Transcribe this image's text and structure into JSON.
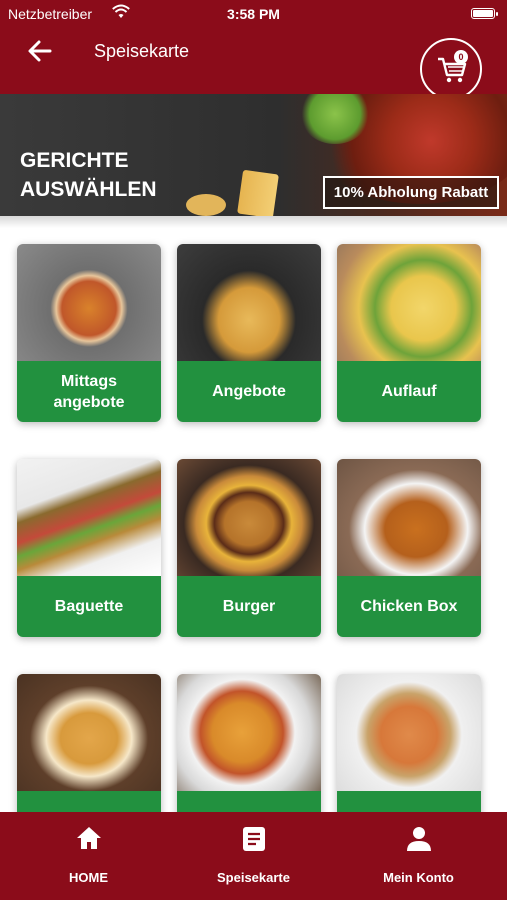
{
  "status_bar": {
    "carrier": "Netzbetreiber",
    "time": "3:58 PM"
  },
  "header": {
    "title": "Speisekarte",
    "cart_count": "0"
  },
  "banner": {
    "title": "GERICHTE AUSWÄHLEN",
    "promo": "10% Abholung Rabatt"
  },
  "categories": [
    {
      "label": "Mittags angebote"
    },
    {
      "label": "Angebote"
    },
    {
      "label": "Auflauf"
    },
    {
      "label": "Baguette"
    },
    {
      "label": "Burger"
    },
    {
      "label": "Chicken Box"
    },
    {
      "label": ""
    },
    {
      "label": ""
    },
    {
      "label": ""
    }
  ],
  "bottom_nav": [
    {
      "label": "HOME",
      "icon": "home-icon"
    },
    {
      "label": "Speisekarte",
      "icon": "menu-icon"
    },
    {
      "label": "Mein Konto",
      "icon": "user-icon"
    }
  ],
  "colors": {
    "primary": "#8b0c1a",
    "accent": "#22913f"
  }
}
